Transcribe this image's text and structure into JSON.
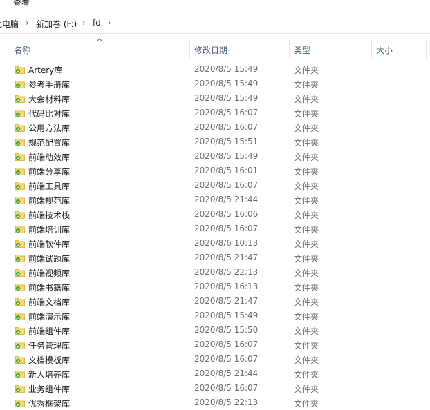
{
  "menu": {
    "view_label": "查看"
  },
  "address": {
    "crumbs": [
      "此电脑",
      "新加卷 (F:)",
      "fd"
    ]
  },
  "columns": {
    "name": "名称",
    "modified": "修改日期",
    "type": "类型",
    "size": "大小"
  },
  "files": [
    {
      "name": "Artery库",
      "modified": "2020/8/5 15:49",
      "type": "文件夹"
    },
    {
      "name": "参考手册库",
      "modified": "2020/8/5 15:49",
      "type": "文件夹"
    },
    {
      "name": "大会材料库",
      "modified": "2020/8/5 15:49",
      "type": "文件夹"
    },
    {
      "name": "代码比对库",
      "modified": "2020/8/5 16:07",
      "type": "文件夹"
    },
    {
      "name": "公用方法库",
      "modified": "2020/8/5 16:07",
      "type": "文件夹"
    },
    {
      "name": "规范配置库",
      "modified": "2020/8/5 15:51",
      "type": "文件夹"
    },
    {
      "name": "前端动效库",
      "modified": "2020/8/5 15:49",
      "type": "文件夹"
    },
    {
      "name": "前端分享库",
      "modified": "2020/8/5 16:01",
      "type": "文件夹"
    },
    {
      "name": "前端工具库",
      "modified": "2020/8/5 16:07",
      "type": "文件夹"
    },
    {
      "name": "前端规范库",
      "modified": "2020/8/5 21:44",
      "type": "文件夹"
    },
    {
      "name": "前端技术栈",
      "modified": "2020/8/5 16:06",
      "type": "文件夹"
    },
    {
      "name": "前端培训库",
      "modified": "2020/8/5 16:07",
      "type": "文件夹"
    },
    {
      "name": "前端软件库",
      "modified": "2020/8/6 10:13",
      "type": "文件夹"
    },
    {
      "name": "前端试题库",
      "modified": "2020/8/5 21:47",
      "type": "文件夹"
    },
    {
      "name": "前端视频库",
      "modified": "2020/8/5 22:13",
      "type": "文件夹"
    },
    {
      "name": "前端书籍库",
      "modified": "2020/8/5 16:13",
      "type": "文件夹"
    },
    {
      "name": "前端文档库",
      "modified": "2020/8/5 21:47",
      "type": "文件夹"
    },
    {
      "name": "前端演示库",
      "modified": "2020/8/5 15:49",
      "type": "文件夹"
    },
    {
      "name": "前端组件库",
      "modified": "2020/8/5 15:50",
      "type": "文件夹"
    },
    {
      "name": "任务管理库",
      "modified": "2020/8/5 16:07",
      "type": "文件夹"
    },
    {
      "name": "文档模板库",
      "modified": "2020/8/5 16:07",
      "type": "文件夹"
    },
    {
      "name": "新人培养库",
      "modified": "2020/8/5 21:44",
      "type": "文件夹"
    },
    {
      "name": "业务组件库",
      "modified": "2020/8/5 16:07",
      "type": "文件夹"
    },
    {
      "name": "优秀框架库",
      "modified": "2020/8/5 22:13",
      "type": "文件夹"
    }
  ],
  "colors": {
    "folder": "#f6d77a",
    "folder_dark": "#e4b94a",
    "sync_badge": "#3aa838",
    "header_text": "#4c607a"
  },
  "icons": {
    "folder": "folder-icon",
    "sync": "sync-check-icon",
    "breadcrumb_sep": "chevron-right-icon",
    "sort": "sort-up-icon"
  }
}
